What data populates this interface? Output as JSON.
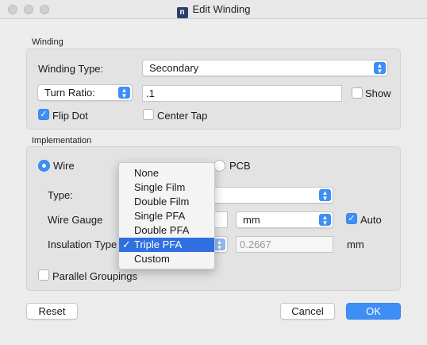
{
  "window": {
    "title": "Edit Winding"
  },
  "winding": {
    "section_label": "Winding",
    "type_label": "Winding Type:",
    "type_value": "Secondary",
    "ratio_mode": "Turn Ratio:",
    "ratio_value": ".1",
    "show_label": "Show",
    "flip_dot_label": "Flip Dot",
    "center_tap_label": "Center Tap"
  },
  "implementation": {
    "section_label": "Implementation",
    "wire_label": "Wire",
    "pcb_label": "PCB",
    "type_label": "Type:",
    "wire_gauge_label": "Wire Gauge",
    "unit_value": "mm",
    "auto_label": "Auto",
    "insulation_label": "Insulation Type",
    "insulation_thickness": "0.2667",
    "thickness_unit": "mm",
    "parallel_label": "Parallel Groupings"
  },
  "insulation_menu": {
    "items": [
      "None",
      "Single Film",
      "Double Film",
      "Single PFA",
      "Double PFA",
      "Triple PFA",
      "Custom"
    ],
    "selected": "Triple PFA"
  },
  "buttons": {
    "reset": "Reset",
    "cancel": "Cancel",
    "ok": "OK"
  }
}
